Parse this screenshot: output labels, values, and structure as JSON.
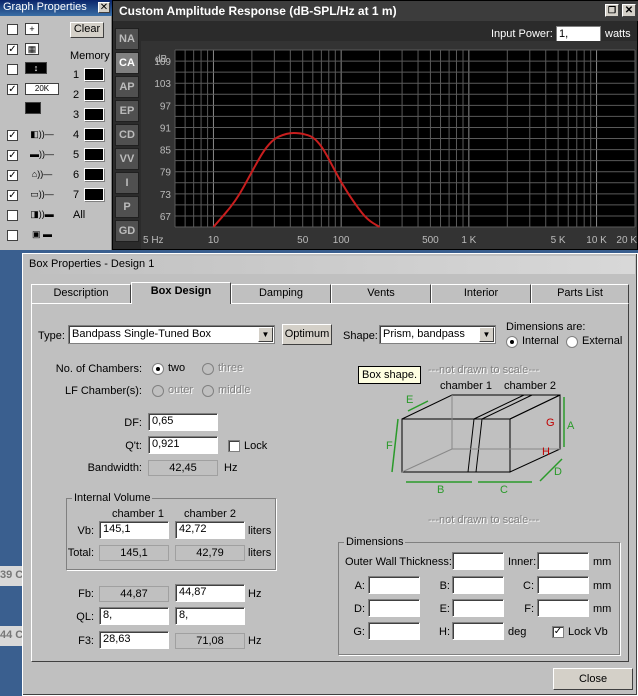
{
  "graph_properties": {
    "title": "Graph Properties",
    "clear_label": "Clear",
    "memory_label": "Memory",
    "memory_slots": [
      "1",
      "2",
      "3",
      "4",
      "5",
      "6",
      "7"
    ],
    "all_label": "All",
    "grid_icon_text": "20K"
  },
  "chart_window": {
    "title": "Custom Amplitude Response (dB-SPL/Hz at 1 m)",
    "input_power_label": "Input Power:",
    "input_power_value": "1,",
    "input_power_unit": "watts",
    "side_tabs": [
      "NA",
      "CA",
      "AP",
      "EP",
      "CD",
      "VV",
      "I",
      "P",
      "GD"
    ],
    "active_tab": "CA"
  },
  "chart_data": {
    "type": "line",
    "title": "Custom Amplitude Response (dB-SPL/Hz at 1 m)",
    "ylabel": "dB",
    "y_ticks": [
      109,
      103,
      97,
      91,
      85,
      79,
      73,
      67
    ],
    "x_ticks": [
      "5 Hz",
      "10",
      "50",
      "100",
      "500",
      "1 K",
      "5 K",
      "10 K",
      "20 K"
    ],
    "x_scale": "log",
    "xlim": [
      5,
      20000
    ],
    "ylim": [
      64,
      112
    ],
    "grid": true,
    "series": [
      {
        "color": "#c81e1e",
        "x": [
          10,
          15,
          20,
          25,
          30,
          35,
          40,
          45,
          50,
          60,
          70,
          80,
          100,
          130,
          160,
          200
        ],
        "y": [
          64,
          71,
          79,
          85,
          88,
          89,
          89.5,
          89.5,
          89.3,
          88.5,
          86,
          82.5,
          76,
          70,
          66,
          64
        ]
      }
    ]
  },
  "dialog": {
    "title": "Box Properties - Design 1",
    "tabs": [
      "Description",
      "Box Design",
      "Damping",
      "Vents",
      "Interior",
      "Parts List"
    ],
    "active_tab": "Box Design",
    "type_label": "Type:",
    "type_value": "Bandpass Single-Tuned Box",
    "optimum_label": "Optimum",
    "shape_label": "Shape:",
    "shape_value": "Prism, bandpass",
    "dimensions_are_label": "Dimensions are:",
    "internal_label": "Internal",
    "external_label": "External",
    "chambers_label": "No. of Chambers:",
    "two_label": "two",
    "three_label": "three",
    "lf_label": "LF Chamber(s):",
    "outer_label": "outer",
    "middle_label": "middle",
    "df_label": "DF:",
    "df_value": "0,65",
    "qt_label": "Q't:",
    "qt_value": "0,921",
    "lock_label": "Lock",
    "bandwidth_label": "Bandwidth:",
    "bandwidth_value": "42,45",
    "bandwidth_unit": "Hz",
    "internal_volume_label": "Internal Volume",
    "chamber1_label": "chamber 1",
    "chamber2_label": "chamber 2",
    "vb_label": "Vb:",
    "vb1": "145,1",
    "vb2": "42,72",
    "liters": "liters",
    "total_label": "Total:",
    "total1": "145,1",
    "total2": "42,79",
    "fb_label": "Fb:",
    "fb1": "44,87",
    "fb2": "44,87",
    "ql_label": "QL:",
    "ql1": "8,",
    "ql2": "8,",
    "f3_label": "F3:",
    "f3_1": "28,63",
    "f3_2": "71,08",
    "hz": "Hz",
    "tooltip": "Box shape.",
    "not_to_scale": "---not drawn to scale---",
    "diagram_chamber1": "chamber 1",
    "diagram_chamber2": "chamber 2",
    "diagram_letters": [
      "E",
      "F",
      "G",
      "A",
      "H",
      "D",
      "B",
      "C"
    ],
    "dimensions_group_label": "Dimensions",
    "outer_wall_label": "Outer Wall Thickness:",
    "inner_label": "Inner:",
    "mm": "mm",
    "deg": "deg",
    "dim_labels": [
      "A:",
      "B:",
      "C:",
      "D:",
      "E:",
      "F:",
      "G:",
      "H:"
    ],
    "lock_vb_label": "Lock Vb",
    "close_label": "Close"
  },
  "background_fragments": [
    "39 C",
    "44 C"
  ]
}
